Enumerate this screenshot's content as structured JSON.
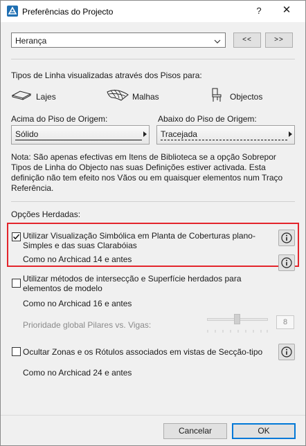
{
  "window": {
    "title": "Preferências do Projecto",
    "help_glyph": "?",
    "close_glyph": "✕"
  },
  "preset": {
    "selected": "Herança",
    "prev_label": "<<",
    "next_label": ">>"
  },
  "line_types": {
    "heading": "Tipos de Linha visualizadas através dos Pisos para:",
    "items": [
      {
        "icon": "slab-icon",
        "label": "Lajes"
      },
      {
        "icon": "mesh-icon",
        "label": "Malhas"
      },
      {
        "icon": "chair-icon",
        "label": "Objectos"
      }
    ],
    "above_label": "Acima do Piso de Origem:",
    "above_value": "Sólido",
    "below_label": "Abaixo do Piso de Origem:",
    "below_value": "Tracejada",
    "note": "Nota: São apenas efectivas em Itens de Biblioteca se a opção Sobrepor Tipos de Linha do Objecto nas suas Definições estiver activada. Esta definição não tem efeito nos Vãos ou em quaisquer elementos num Traço Referência."
  },
  "inherited": {
    "heading": "Opções Herdadas:",
    "options": [
      {
        "label": "Utilizar Visualização Simbólica em Planta de Coberturas plano-Simples e das suas Clarabóias",
        "checked": true,
        "sub": "Como no Archicad 14 e antes"
      },
      {
        "label": "Utilizar métodos de intersecção e Superfície herdados para elementos de modelo",
        "checked": false,
        "sub": "Como no Archicad 16 e antes"
      },
      {
        "label": "Ocultar Zonas e os Rótulos associados em vistas de Secção-tipo",
        "checked": false,
        "sub": "Como no Archicad 24 e antes"
      }
    ],
    "priority_label": "Prioridade global Pilares vs. Vigas:",
    "priority_value": "8",
    "priority_level": 0.5
  },
  "footer": {
    "cancel_label": "Cancelar",
    "ok_label": "OK"
  },
  "colors": {
    "highlight": "#e3242b",
    "accent": "#0078d7"
  }
}
